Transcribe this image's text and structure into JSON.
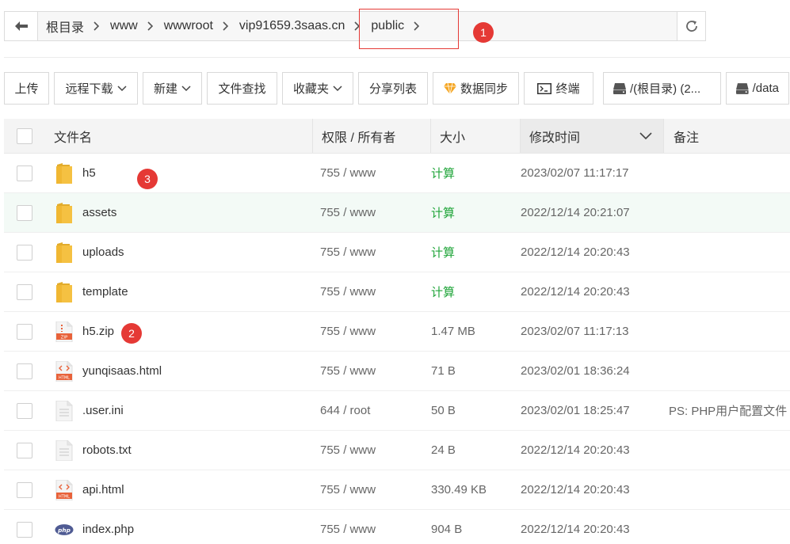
{
  "breadcrumb": {
    "items": [
      "根目录",
      "www",
      "wwwroot",
      "vip91659.3saas.cn",
      "public"
    ]
  },
  "annotations": {
    "m1": "1",
    "m2": "2",
    "m3": "3"
  },
  "toolbar": {
    "upload": "上传",
    "remote_download": "远程下载",
    "new": "新建",
    "file_search": "文件查找",
    "favorites": "收藏夹",
    "share_list": "分享列表",
    "data_sync": "数据同步",
    "terminal": "终端",
    "disk_root": "/(根目录) (2...",
    "disk_data": "/data"
  },
  "table": {
    "headers": {
      "name": "文件名",
      "perm": "权限 / 所有者",
      "size": "大小",
      "mtime": "修改时间",
      "note": "备注"
    },
    "rows": [
      {
        "name": "h5",
        "icon": "folder-icon",
        "perm": "755 / www",
        "size": "计算",
        "mtime": "2023/02/07 11:17:17",
        "note": ""
      },
      {
        "name": "assets",
        "icon": "folder-icon",
        "perm": "755 / www",
        "size": "计算",
        "mtime": "2022/12/14 20:21:07",
        "note": ""
      },
      {
        "name": "uploads",
        "icon": "folder-icon",
        "perm": "755 / www",
        "size": "计算",
        "mtime": "2022/12/14 20:20:43",
        "note": ""
      },
      {
        "name": "template",
        "icon": "folder-icon",
        "perm": "755 / www",
        "size": "计算",
        "mtime": "2022/12/14 20:20:43",
        "note": ""
      },
      {
        "name": "h5.zip",
        "icon": "zip-file-icon",
        "perm": "755 / www",
        "size": "1.47 MB",
        "mtime": "2023/02/07 11:17:13",
        "note": ""
      },
      {
        "name": "yunqisaas.html",
        "icon": "html-file-icon",
        "perm": "755 / www",
        "size": "71 B",
        "mtime": "2023/02/01 18:36:24",
        "note": ""
      },
      {
        "name": ".user.ini",
        "icon": "text-file-icon",
        "perm": "644 / root",
        "size": "50 B",
        "mtime": "2023/02/01 18:25:47",
        "note": "PS: PHP用户配置文件"
      },
      {
        "name": "robots.txt",
        "icon": "text-file-icon",
        "perm": "755 / www",
        "size": "24 B",
        "mtime": "2022/12/14 20:20:43",
        "note": ""
      },
      {
        "name": "api.html",
        "icon": "html-file-icon",
        "perm": "755 / www",
        "size": "330.49 KB",
        "mtime": "2022/12/14 20:20:43",
        "note": ""
      },
      {
        "name": "index.php",
        "icon": "php-file-icon",
        "perm": "755 / www",
        "size": "904 B",
        "mtime": "2022/12/14 20:20:43",
        "note": ""
      }
    ]
  },
  "colors": {
    "accent_green": "#20a53a",
    "annotation_red": "#e53935",
    "folder_yellow": "#f5c142"
  }
}
